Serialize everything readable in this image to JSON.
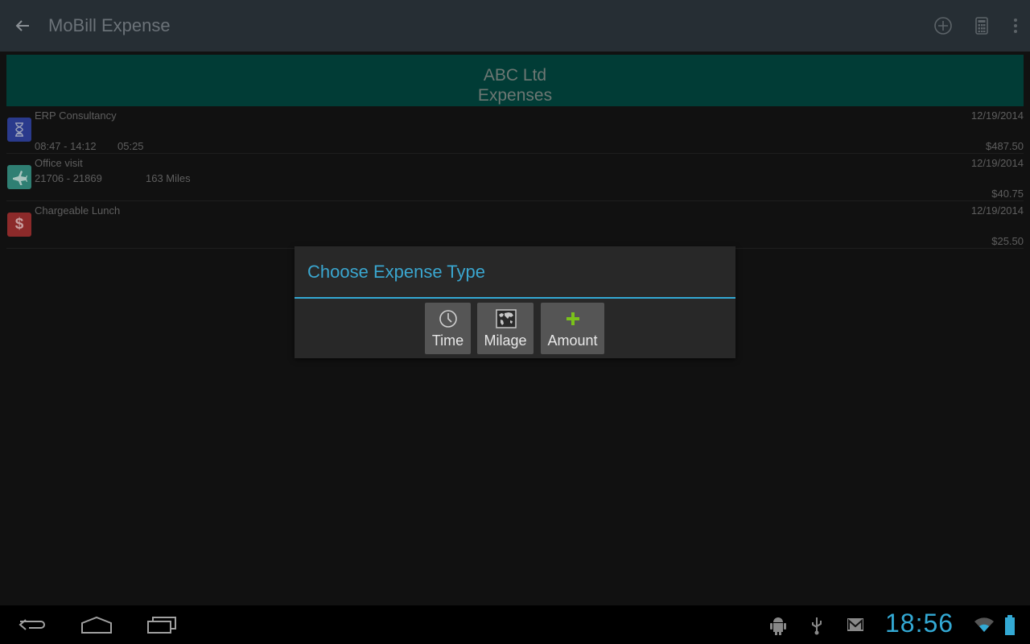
{
  "action_bar": {
    "title": "MoBill Expense",
    "icons": [
      "back-arrow-icon",
      "add-circle-icon",
      "calculator-icon",
      "overflow-menu-icon"
    ]
  },
  "header": {
    "company": "ABC Ltd",
    "subtitle": "Expenses"
  },
  "expenses": [
    {
      "type": "time",
      "icon": "hourglass-icon",
      "icon_color": "#2a3a8c",
      "title": "ERP Consultancy",
      "detail": "08:47 - 14:12",
      "extra": "05:25",
      "date": "12/19/2014",
      "amount": "$487.50"
    },
    {
      "type": "mileage",
      "icon": "airplane-icon",
      "icon_color": "#2f7f73",
      "title": "Office visit",
      "detail": "21706 - 21869",
      "extra": "163 Miles",
      "date": "12/19/2014",
      "amount": "$40.75"
    },
    {
      "type": "amount",
      "icon": "dollar-icon",
      "icon_color": "#8c2a2a",
      "title": "Chargeable Lunch",
      "detail": "",
      "extra": "",
      "date": "12/19/2014",
      "amount": "$25.50"
    }
  ],
  "dialog": {
    "title": "Choose Expense Type",
    "accent": "#33a9d4",
    "buttons": [
      {
        "label": "Time",
        "icon": "clock-icon"
      },
      {
        "label": "Milage",
        "icon": "map-icon"
      },
      {
        "label": "Amount",
        "icon": "plus-icon"
      }
    ]
  },
  "system_bar": {
    "time": "18:56",
    "nav": [
      "back-icon",
      "home-icon",
      "recent-apps-icon"
    ],
    "status_icons": [
      "android-debug-icon",
      "usb-icon",
      "gmail-icon",
      "wifi-icon",
      "battery-icon"
    ]
  }
}
